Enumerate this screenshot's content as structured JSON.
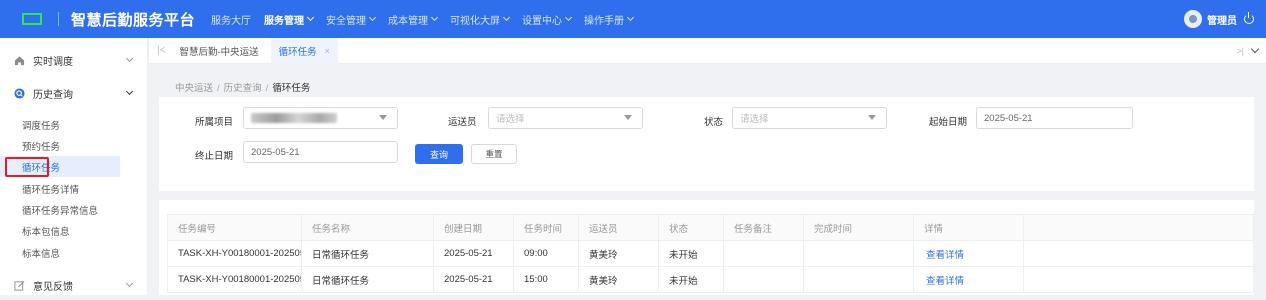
{
  "header": {
    "app_title": "智慧后勤服务平台",
    "nav": [
      {
        "label": "服务大厅",
        "has_dropdown": false
      },
      {
        "label": "服务管理",
        "has_dropdown": true,
        "active": true
      },
      {
        "label": "安全管理",
        "has_dropdown": true
      },
      {
        "label": "成本管理",
        "has_dropdown": true
      },
      {
        "label": "可视化大屏",
        "has_dropdown": true
      },
      {
        "label": "设置中心",
        "has_dropdown": true
      },
      {
        "label": "操作手册",
        "has_dropdown": true
      }
    ],
    "user_name": "管理员",
    "brand_color": "#2f6fed",
    "logo_color": "#2ee84e"
  },
  "sidebar": {
    "groups": [
      {
        "label": "实时调度",
        "icon": "home-icon",
        "expanded": false
      },
      {
        "label": "历史查询",
        "icon": "history-icon",
        "expanded": true
      },
      {
        "label": "意见反馈",
        "icon": "edit-icon",
        "expanded": false
      }
    ],
    "items": [
      "调度任务",
      "预约任务",
      "循环任务",
      "循环任务详情",
      "循环任务异常信息",
      "标本包信息",
      "标本信息"
    ],
    "active_item": "循环任务"
  },
  "tabs": {
    "items": [
      {
        "label": "智慧后勤-中央运送",
        "active": false
      },
      {
        "label": "循环任务",
        "active": true,
        "close": "×"
      }
    ]
  },
  "breadcrumb": {
    "items": [
      "中央运送",
      "历史查询",
      "循环任务"
    ],
    "separator": "/"
  },
  "filters": {
    "project_label": "所属项目",
    "courier_label": "运送员",
    "courier_placeholder": "请选择",
    "status_label": "状态",
    "status_placeholder": "请选择",
    "start_date_label": "起始日期",
    "start_date_value": "2025-05-21",
    "end_date_label": "终止日期",
    "end_date_value": "2025-05-21",
    "query_button": "查询",
    "reset_button": "重置"
  },
  "table": {
    "columns": [
      "任务编号",
      "任务名称",
      "创建日期",
      "任务时间",
      "运送员",
      "状态",
      "任务备注",
      "完成时间",
      "详情"
    ],
    "rows": [
      [
        "TASK-XH-Y00180001-202505",
        "日常循环任务",
        "2025-05-21",
        "09:00",
        "黄美玲",
        "未开始",
        "",
        "",
        "查看详情"
      ],
      [
        "TASK-XH-Y00180001-202505",
        "日常循环任务",
        "2025-05-21",
        "15:00",
        "黄美玲",
        "未开始",
        "",
        "",
        "查看详情"
      ]
    ]
  }
}
